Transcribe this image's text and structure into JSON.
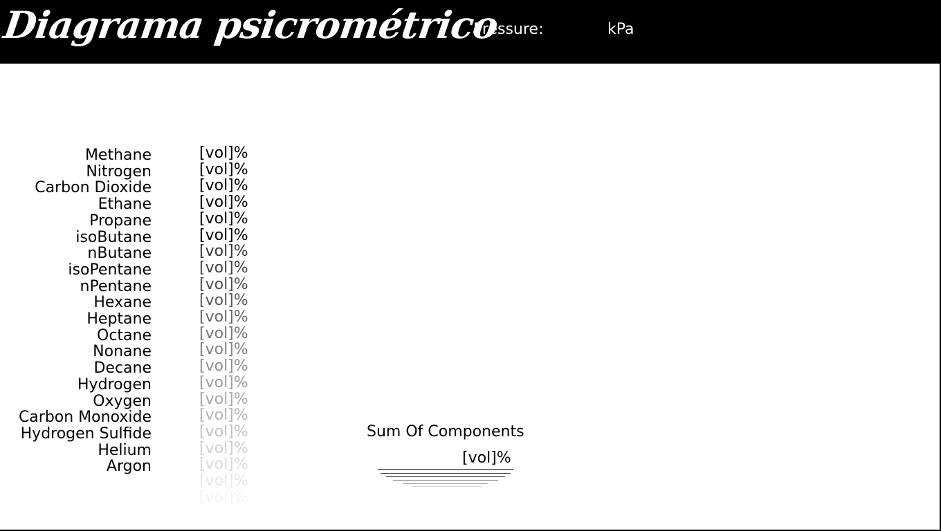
{
  "header": {
    "title": "Diagrama psicrométrico",
    "pressure_label": "Pressure:",
    "pressure_unit": "kPa"
  },
  "components": [
    {
      "name": "Methane",
      "unit": "[vol]%"
    },
    {
      "name": "Nitrogen",
      "unit": "[vol]%"
    },
    {
      "name": "Carbon Dioxide",
      "unit": "[vol]%"
    },
    {
      "name": "Ethane",
      "unit": "[vol]%"
    },
    {
      "name": "Propane",
      "unit": "[vol]%"
    },
    {
      "name": "isoButane",
      "unit": "[vol]%"
    },
    {
      "name": "nButane",
      "unit": "[vol]%"
    },
    {
      "name": "isoPentane",
      "unit": "[vol]%"
    },
    {
      "name": "nPentane",
      "unit": "[vol]%"
    },
    {
      "name": "Hexane",
      "unit": "[vol]%"
    },
    {
      "name": "Heptane",
      "unit": "[vol]%"
    },
    {
      "name": "Octane",
      "unit": "[vol]%"
    },
    {
      "name": "Nonane",
      "unit": "[vol]%"
    },
    {
      "name": "Decane",
      "unit": "[vol]%"
    },
    {
      "name": "Hydrogen",
      "unit": "[vol]%"
    },
    {
      "name": "Oxygen",
      "unit": "[vol]%"
    },
    {
      "name": "Carbon Monoxide",
      "unit": "[vol]%"
    },
    {
      "name": "Hydrogen Sulfide",
      "unit": "[vol]%"
    },
    {
      "name": "Helium",
      "unit": "[vol]%"
    },
    {
      "name": "Argon",
      "unit": "[vol]%"
    }
  ],
  "extra_unit_rows": [
    "[vol]%",
    "[vol]%"
  ],
  "sum": {
    "title": "Sum Of Components",
    "unit": "[vol]%"
  }
}
